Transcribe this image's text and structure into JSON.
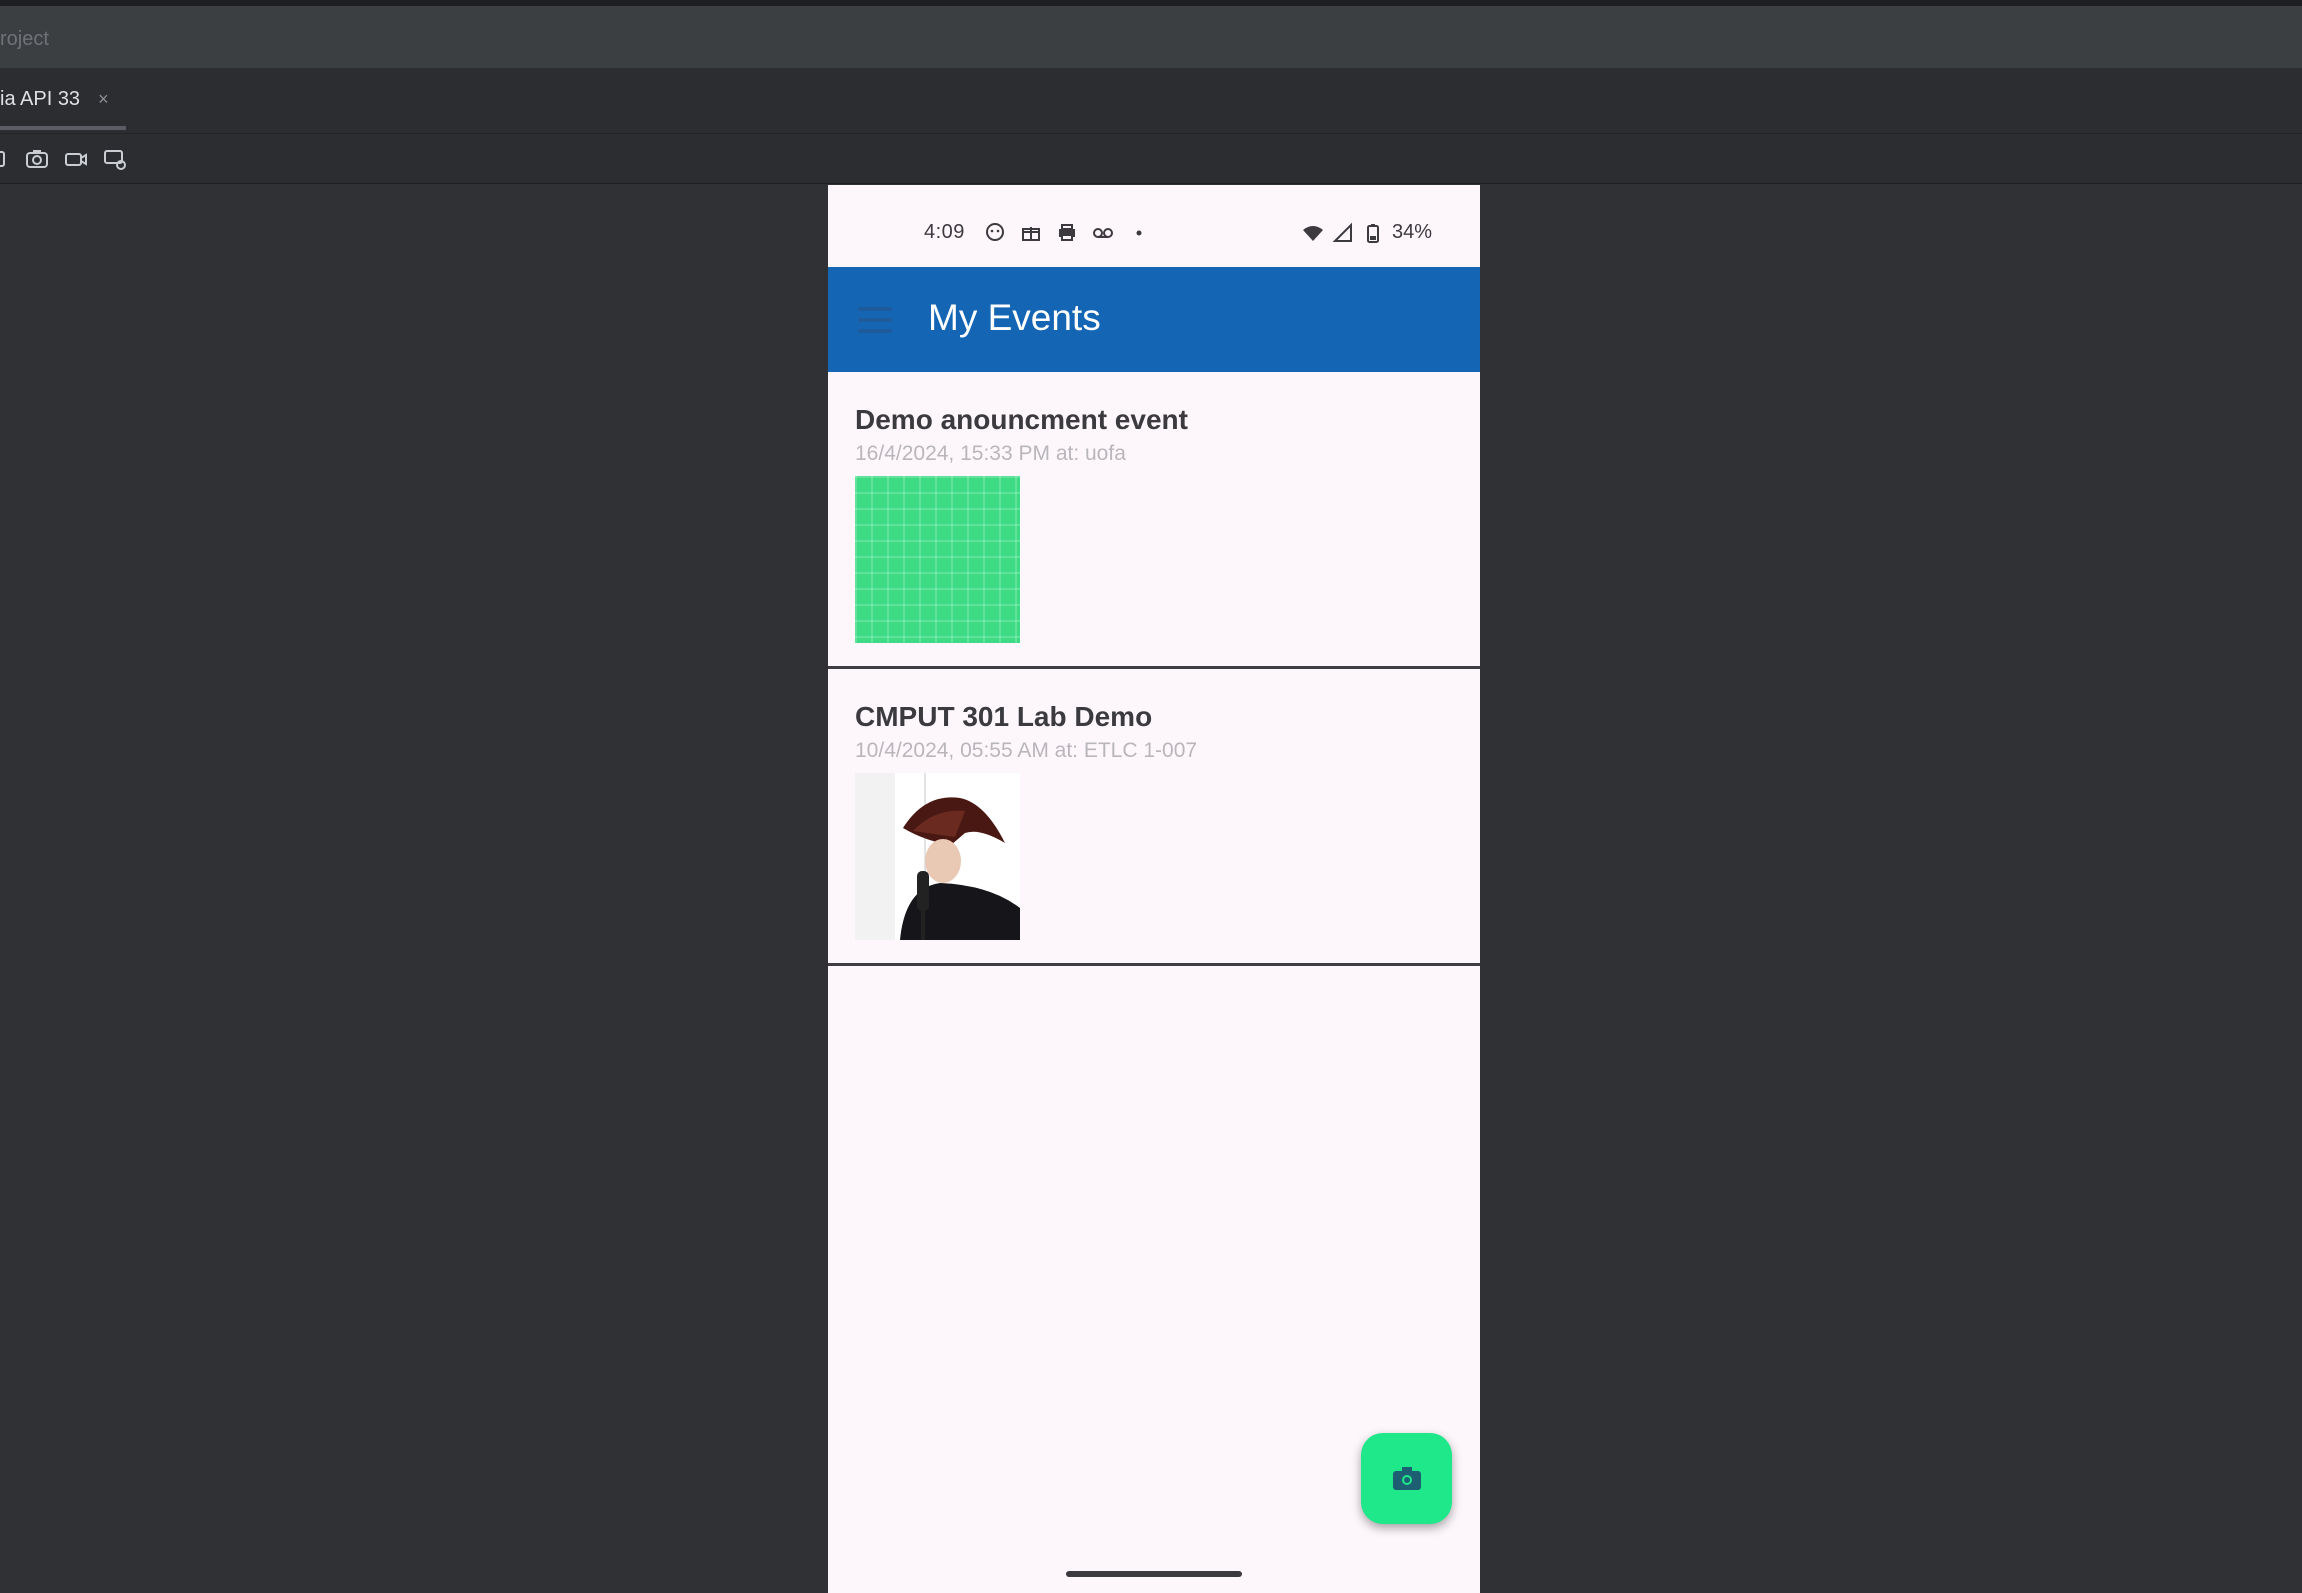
{
  "ide": {
    "project_label": "roject",
    "tab_label": "ia API 33",
    "tab_close": "×",
    "toolbar_icons": [
      "pin-icon",
      "camera-icon",
      "video-icon",
      "settings-screen-icon"
    ]
  },
  "device": {
    "status_bar": {
      "time": "4:09",
      "left_icons": [
        "face-icon",
        "gift-icon",
        "print-icon",
        "voicemail-icon",
        "dot-icon"
      ],
      "right_icons": [
        "wifi-icon",
        "signal-icon",
        "battery-icon"
      ],
      "battery": "34%"
    },
    "app_bar": {
      "menu_icon": "hamburger-icon",
      "title": "My Events"
    },
    "events": [
      {
        "title": "Demo anouncment event",
        "meta": "16/4/2024, 15:33 PM at: uofa",
        "thumb": "green-grid"
      },
      {
        "title": "CMPUT 301 Lab Demo",
        "meta": "10/4/2024, 05:55 AM at: ETLC 1-007",
        "thumb": "photo"
      }
    ],
    "fab": {
      "icon": "camera-icon",
      "color": "#1ee88a"
    },
    "colors": {
      "app_bar": "#1565b5",
      "background": "#fdf7fb"
    }
  }
}
